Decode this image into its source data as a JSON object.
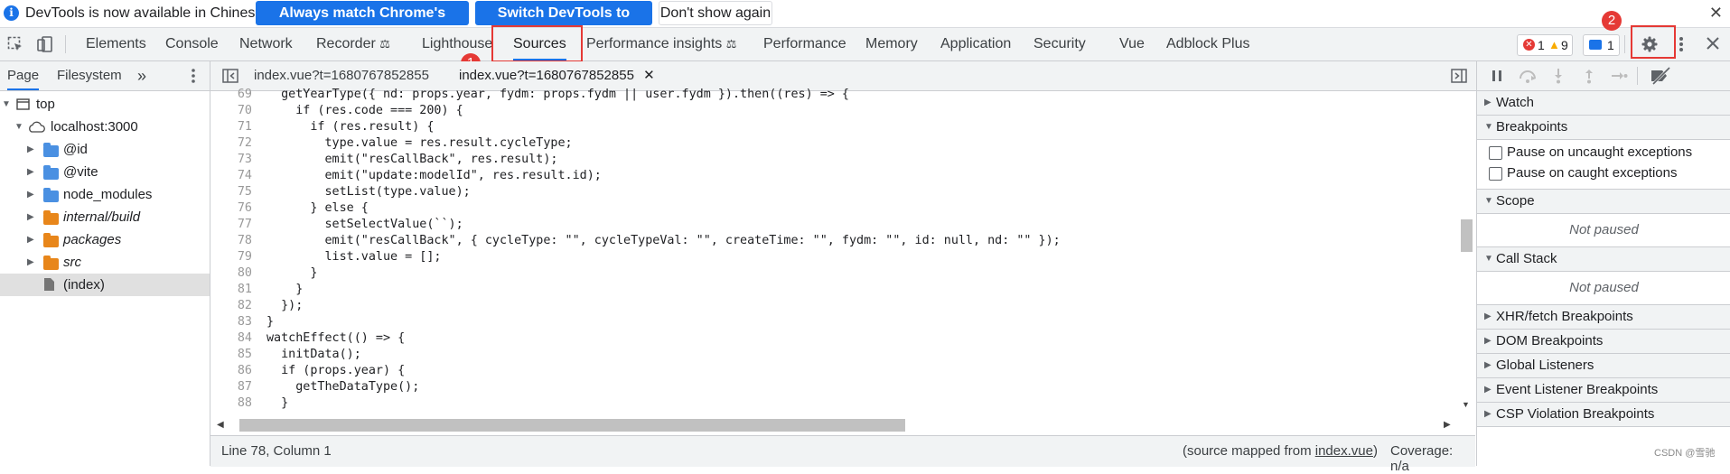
{
  "infobar": {
    "message": "DevTools is now available in Chinese!",
    "match_button": "Always match Chrome's language",
    "switch_button": "Switch DevTools to Chinese",
    "dismiss_button": "Don't show again",
    "close": "✕"
  },
  "tabs": [
    "Elements",
    "Console",
    "Network",
    "Recorder",
    "Lighthouse",
    "Sources",
    "Performance insights",
    "Performance",
    "Memory",
    "Application",
    "Security",
    "Vue",
    "Adblock Plus"
  ],
  "active_tab": "Sources",
  "counters": {
    "errors": "1",
    "warnings": "9",
    "messages": "1"
  },
  "annotations": {
    "sources_marker": "1",
    "settings_marker": "2"
  },
  "navigator": {
    "tabs": [
      "Page",
      "Filesystem"
    ],
    "more": "»",
    "tree": [
      {
        "label": "top"
      },
      {
        "label": "localhost:3000"
      },
      {
        "label": "@id"
      },
      {
        "label": "@vite"
      },
      {
        "label": "node_modules"
      },
      {
        "label": "internal/build"
      },
      {
        "label": "packages"
      },
      {
        "label": "src"
      },
      {
        "label": "(index)"
      }
    ]
  },
  "editor_tabs": [
    "index.vue?t=1680767852855",
    "index.vue?t=1680767852855"
  ],
  "code_lines": [
    {
      "n": "69",
      "text": "  getYearType({ nd: props.year, fydm: props.fydm || user.fydm }).then((res) => {"
    },
    {
      "n": "70",
      "text": "    if (res.code === 200) {"
    },
    {
      "n": "71",
      "text": "      if (res.result) {"
    },
    {
      "n": "72",
      "text": "        type.value = res.result.cycleType;"
    },
    {
      "n": "73",
      "text": "        emit(\"resCallBack\", res.result);"
    },
    {
      "n": "74",
      "text": "        emit(\"update:modelId\", res.result.id);"
    },
    {
      "n": "75",
      "text": "        setList(type.value);"
    },
    {
      "n": "76",
      "text": "      } else {"
    },
    {
      "n": "77",
      "text": "        setSelectValue(``);"
    },
    {
      "n": "78",
      "text": "        emit(\"resCallBack\", { cycleType: \"\", cycleTypeVal: \"\", createTime: \"\", fydm: \"\", id: null, nd: \"\" });"
    },
    {
      "n": "79",
      "text": "        list.value = [];"
    },
    {
      "n": "80",
      "text": "      }"
    },
    {
      "n": "81",
      "text": "    }"
    },
    {
      "n": "82",
      "text": "  });"
    },
    {
      "n": "83",
      "text": "}"
    },
    {
      "n": "84",
      "text": "watchEffect(() => {"
    },
    {
      "n": "85",
      "text": "  initData();"
    },
    {
      "n": "86",
      "text": "  if (props.year) {"
    },
    {
      "n": "87",
      "text": "    getTheDataType();"
    },
    {
      "n": "88",
      "text": "  }"
    }
  ],
  "status": {
    "position": "Line 78, Column 1",
    "mapped_prefix": "(source mapped from ",
    "mapped_file": "index.vue",
    "mapped_suffix": ")",
    "coverage": "Coverage: n/a"
  },
  "debugger": {
    "watch": "Watch",
    "breakpoints": "Breakpoints",
    "pause_uncaught": "Pause on uncaught exceptions",
    "pause_caught": "Pause on caught exceptions",
    "scope": "Scope",
    "scope_status": "Not paused",
    "call_stack": "Call Stack",
    "call_stack_status": "Not paused",
    "xhr": "XHR/fetch Breakpoints",
    "dom": "DOM Breakpoints",
    "global": "Global Listeners",
    "event": "Event Listener Breakpoints",
    "csp": "CSP Violation Breakpoints"
  },
  "watermark": "CSDN @雪驰",
  "colors": {
    "accent": "#1a73e8",
    "highlight": "#e53935",
    "folder_blue": "#4a90e2",
    "folder_orange": "#e8861a"
  }
}
